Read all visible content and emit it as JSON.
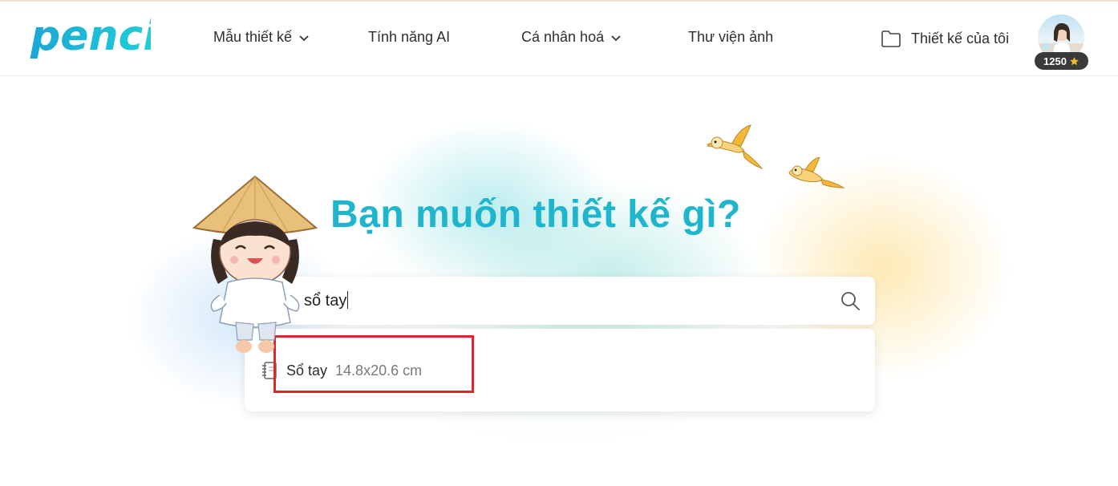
{
  "brand": {
    "logo_text": "penci"
  },
  "nav": [
    {
      "label": "Mẫu thiết kế",
      "has_dropdown": true
    },
    {
      "label": "Tính năng AI",
      "has_dropdown": false
    },
    {
      "label": "Cá nhân hoá",
      "has_dropdown": true
    },
    {
      "label": "Thư viện ảnh",
      "has_dropdown": false
    }
  ],
  "account": {
    "my_designs_label": "Thiết kế của tôi",
    "points": "1250"
  },
  "hero": {
    "title": "Bạn muốn thiết kế gì?"
  },
  "search": {
    "value": "sổ tay"
  },
  "suggestions": [
    {
      "name": "Sổ tay",
      "size": "14.8x20.6 cm",
      "icon": "notebook-icon"
    }
  ],
  "colors": {
    "accent": "#1fb5cc",
    "highlight": "#e0262d",
    "badge_bg": "#3a3a3a"
  }
}
